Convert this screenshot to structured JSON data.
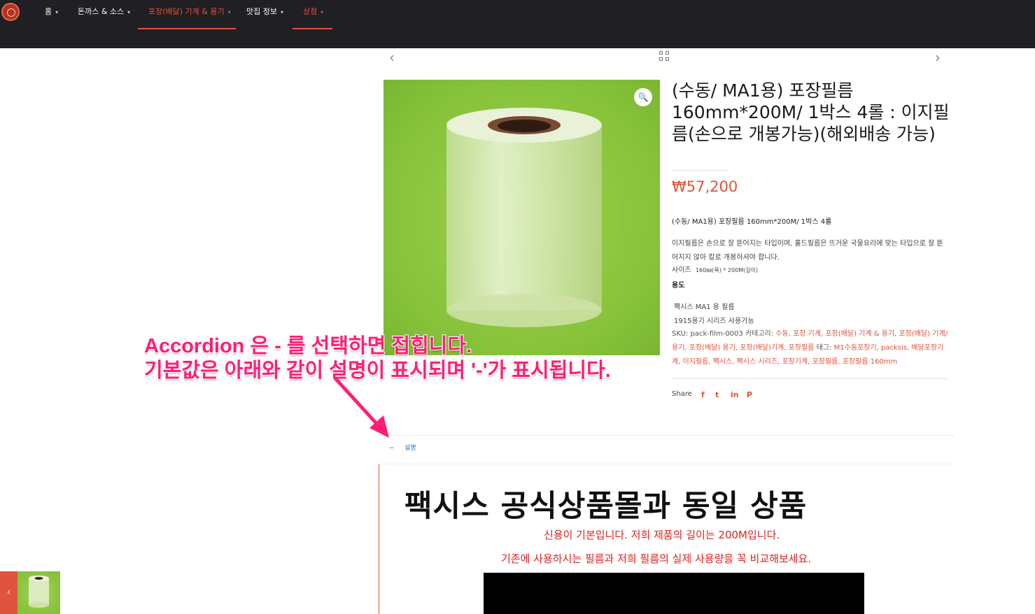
{
  "nav": {
    "items": [
      {
        "label": "홈"
      },
      {
        "label": "돈까스 & 소스"
      },
      {
        "label": "포장(배달) 기계 & 용기"
      },
      {
        "label": "맛집 정보"
      },
      {
        "label": "상점"
      }
    ],
    "caret": "▾",
    "active_color": "#e0533c"
  },
  "pager": {
    "prev_icon": "‹",
    "next_icon": "›",
    "grid_icon": "grid-icon"
  },
  "product": {
    "zoom_icon": "🔍",
    "title": "(수동/ MA1용) 포장필름 160mm*200M/ 1박스 4롤 : 이지필름(손으로 개봉가능)(해외배송 가능)",
    "price": "₩57,200",
    "short_desc": "(수동/ MA1용) 포장필름 160mm*200M/ 1박스 4롤",
    "desc1": "이지필름은 손으로 잘 뜯어지는 타입이며, 홀드필름은 뜨거운 국물요리에 맞는 타입으로 잘 뜯어지지 않아 칼로 개봉하셔야 합니다.",
    "size_label": "사이즈",
    "size_value": "160㎜(폭) * 200M(길이)",
    "usage_label": "용도",
    "usage1": "팩시스 MA1 용 필름",
    "usage2": "1915용기 시리즈 사용가능",
    "meta": {
      "sku_label": "SKU:",
      "sku": "pack-film-0003",
      "cat_label": "카테고리:",
      "categories": "수동, 포장 기계, 포장(배달) 기계 & 용기, 포장(배달) 기계/용기, 포장(배달) 용기, 포장(배달)기계, 포장필름",
      "tag_label": "태그:",
      "tags": "M1수동포장기, packsis, 배달포장기계, 이지필름, 팩시스, 팩시스 시리즈, 포장기계, 포장필름, 포장필름 160mm"
    },
    "share_label": "Share",
    "social": [
      "f",
      "t",
      "in",
      "P"
    ],
    "accent": "#e0533c"
  },
  "accordion": {
    "toggle": "−",
    "label": "설명",
    "link_color": "#1e73be"
  },
  "description": {
    "heading": "팩시스 공식상품몰과 동일 상품",
    "line1": "신용이 기본입니다. 저희 제품의 길이는 200M입니다.",
    "line2": "기존에 사용하시는 필름과 저희 필름의 실제 사용량을 꼭 비교해보세요."
  },
  "annotation": {
    "line1": "Accordion 은 - 를 선택하면 접힙니다.",
    "line2": "기본값은 아래와 같이 설명이 표시되며 '-'가 표시됩니다.",
    "color": "#ff1e74"
  },
  "prev_product": {
    "icon": "‹"
  }
}
